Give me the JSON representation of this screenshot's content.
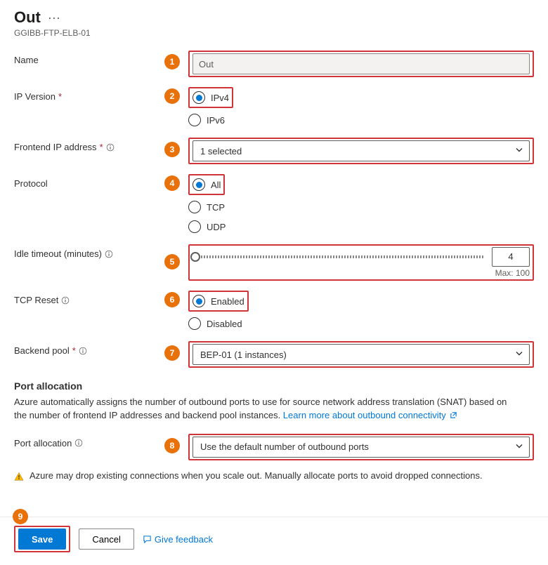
{
  "header": {
    "title": "Out",
    "resource": "GGIBB-FTP-ELB-01"
  },
  "fields": {
    "name": {
      "label": "Name",
      "value": "Out"
    },
    "ip_version": {
      "label": "IP Version",
      "options": [
        "IPv4",
        "IPv6"
      ],
      "selected": "IPv4"
    },
    "frontend_ip": {
      "label": "Frontend IP address",
      "value": "1 selected"
    },
    "protocol": {
      "label": "Protocol",
      "options": [
        "All",
        "TCP",
        "UDP"
      ],
      "selected": "All"
    },
    "idle_timeout": {
      "label": "Idle timeout (minutes)",
      "value": "4",
      "max_label": "Max: 100"
    },
    "tcp_reset": {
      "label": "TCP Reset",
      "options": [
        "Enabled",
        "Disabled"
      ],
      "selected": "Enabled"
    },
    "backend_pool": {
      "label": "Backend pool",
      "value": "BEP-01 (1 instances)"
    },
    "port_allocation": {
      "heading": "Port allocation",
      "description_prefix": "Azure automatically assigns the number of outbound ports to use for source network address translation (SNAT) based on the number of frontend IP addresses and backend pool instances. ",
      "learn_more": "Learn more about outbound connectivity",
      "label": "Port allocation",
      "value": "Use the default number of outbound ports",
      "warning": "Azure may drop existing connections when you scale out. Manually allocate ports to avoid dropped connections."
    }
  },
  "footer": {
    "save": "Save",
    "cancel": "Cancel",
    "feedback": "Give feedback"
  },
  "callouts": {
    "1": "1",
    "2": "2",
    "3": "3",
    "4": "4",
    "5": "5",
    "6": "6",
    "7": "7",
    "8": "8",
    "9": "9"
  }
}
